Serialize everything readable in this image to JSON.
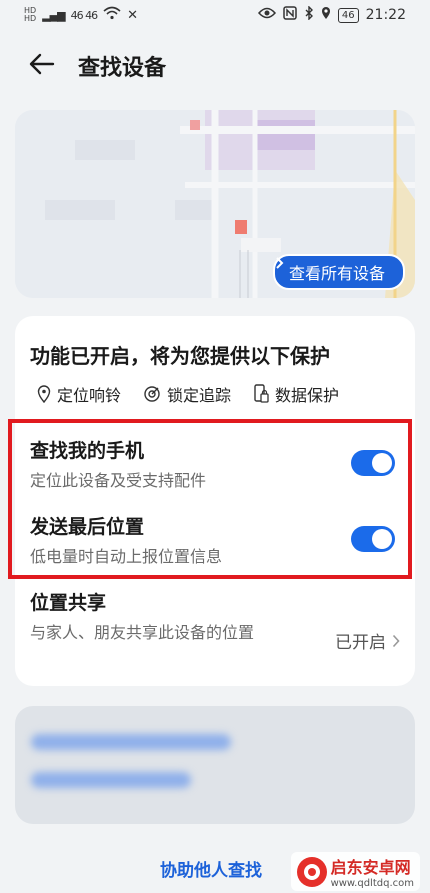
{
  "status_bar": {
    "sim_labels": [
      "HD",
      "HD"
    ],
    "signal_text": "46 46",
    "time": "21:22",
    "battery": "46"
  },
  "header": {
    "title": "查找设备"
  },
  "map": {
    "view_all_label": "查看所有设备"
  },
  "feature_card": {
    "heading": "功能已开启，将为您提供以下保护",
    "protections": [
      {
        "label": "定位响铃",
        "icon": "location-pin-icon"
      },
      {
        "label": "锁定追踪",
        "icon": "lock-track-icon"
      },
      {
        "label": "数据保护",
        "icon": "data-protect-icon"
      }
    ],
    "find_phone": {
      "title": "查找我的手机",
      "desc": "定位此设备及受支持配件",
      "enabled": true
    },
    "send_last_location": {
      "title": "发送最后位置",
      "desc": "低电量时自动上报位置信息",
      "enabled": true
    },
    "location_share": {
      "title": "位置共享",
      "desc": "与家人、朋友共享此设备的位置",
      "status": "已开启"
    }
  },
  "footer": {
    "help_link": "协助他人查找"
  },
  "watermark": {
    "name": "启东安卓网",
    "url": "www.qdltdq.com"
  },
  "colors": {
    "accent": "#1b6bea",
    "highlight": "#e11a1f"
  }
}
